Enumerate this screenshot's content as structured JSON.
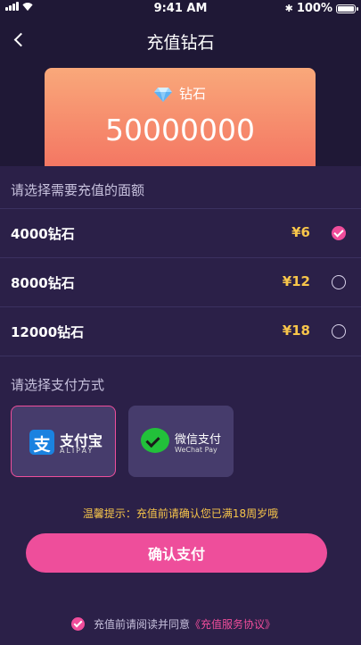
{
  "status_bar": {
    "time": "9:41 AM",
    "battery": "100%",
    "bluetooth": "✱"
  },
  "nav": {
    "title": "充值钻石",
    "back_icon": "chevron-left-icon"
  },
  "balance": {
    "label": "钻石",
    "value": "50000000",
    "icon": "diamond-icon"
  },
  "packages": {
    "title": "请选择需要充值的面额",
    "items": [
      {
        "name": "4000钻石",
        "price": "¥6",
        "selected": true
      },
      {
        "name": "8000钻石",
        "price": "¥12",
        "selected": false
      },
      {
        "name": "12000钻石",
        "price": "¥18",
        "selected": false
      }
    ]
  },
  "payment": {
    "title": "请选择支付方式",
    "alipay": {
      "name": "支付宝",
      "sub": "ALIPAY",
      "selected": true
    },
    "wechat": {
      "name": "微信支付",
      "sub": "WeChat Pay",
      "selected": false
    }
  },
  "tip": "温馨提示：充值前请确认您已满18周岁哦",
  "confirm_button": "确认支付",
  "agreement": {
    "text": "充值前请阅读并同意",
    "link": "《充值服务协议》"
  },
  "colors": {
    "accent": "#ee4e9b",
    "price": "#f7c54a",
    "background": "#2b2048"
  }
}
